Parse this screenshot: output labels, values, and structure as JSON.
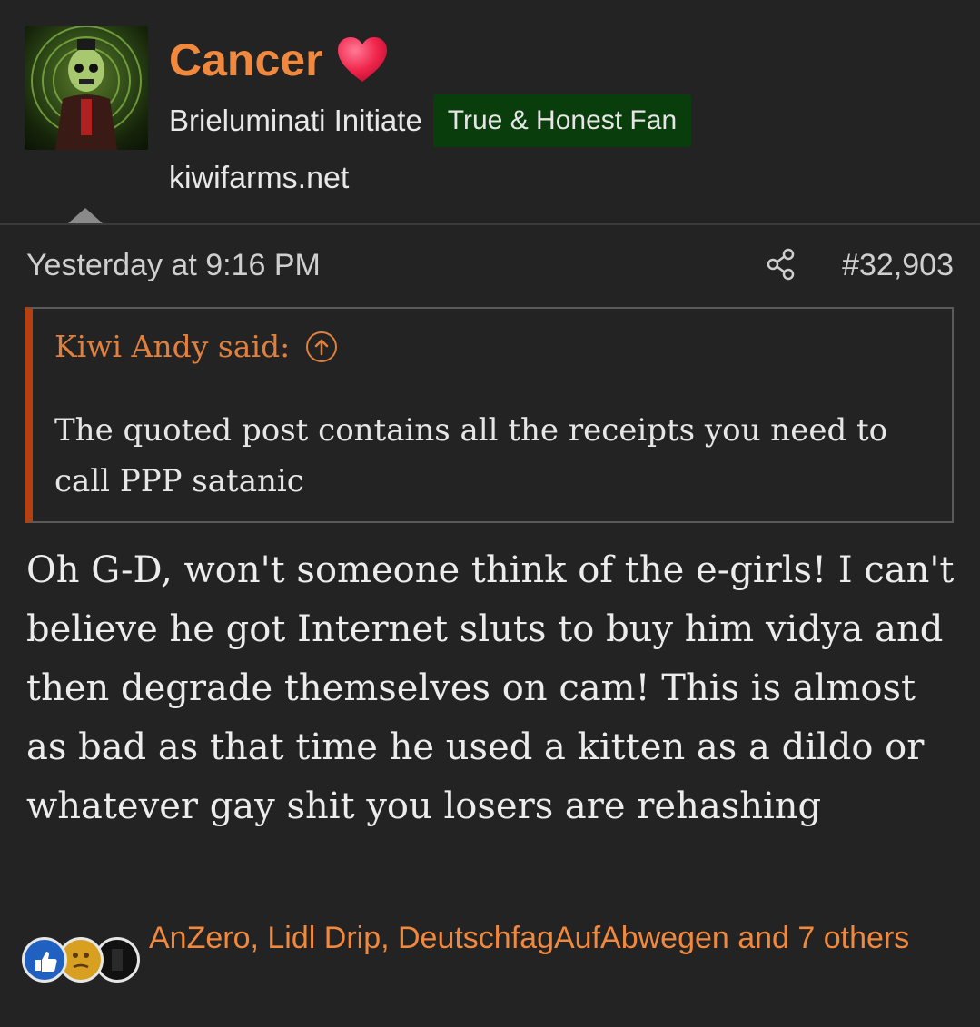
{
  "user": {
    "name": "Cancer",
    "title": "Brieluminati Initiate",
    "badge": "True & Honest Fan",
    "site": "kiwifarms.net"
  },
  "post": {
    "time": "Yesterday at 9:16 PM",
    "number": "#32,903"
  },
  "quote": {
    "author": "Kiwi Andy said:",
    "text": "The quoted post contains all the receipts you need to call PPP satanic"
  },
  "message": "Oh G-D, won't someone think of the e-girls! I can't believe he got Internet sluts to buy him vidya and then degrade themselves on cam! This is almost as bad as that time he used a kitten as a dildo or whatever gay shit you losers are rehashing",
  "reactions": {
    "icons": [
      "thumbs-up-icon",
      "thinking-face-icon",
      "dark-reaction-icon"
    ],
    "text": "AnZero, Lidl Drip, DeutschfagAufAbwegen and 7 others"
  },
  "colors": {
    "background": "#232323",
    "username": "#f0883e",
    "badge": "#093d0c",
    "quote_bar": "#b8400f"
  }
}
